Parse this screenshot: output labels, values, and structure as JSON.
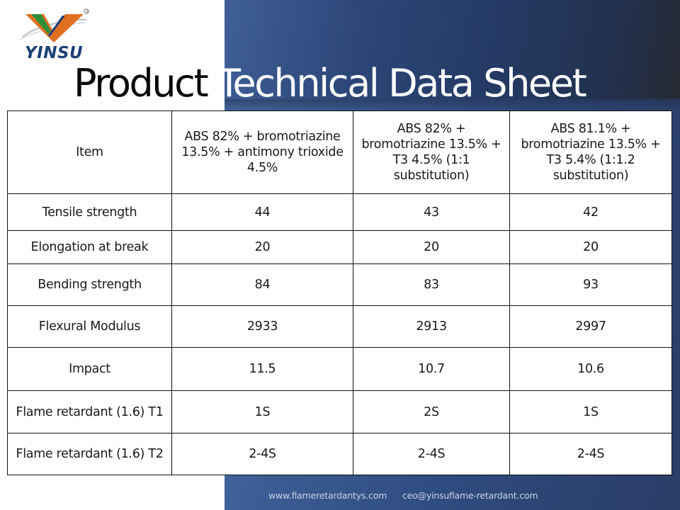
{
  "brand": {
    "name": "YINSU",
    "registered_mark": "®",
    "colors": {
      "green": "#2f8f3a",
      "orange": "#e07020",
      "navy": "#1c3f78"
    }
  },
  "title": {
    "part1": "Product",
    "part2": "Technical Data Sheet"
  },
  "table": {
    "headers": [
      "Item",
      "ABS 82% + bromotriazine 13.5% + antimony trioxide 4.5%",
      "ABS 82% + bromotriazine 13.5% + T3 4.5% (1:1 substitution)",
      "ABS 81.1% + bromotriazine 13.5% + T3 5.4% (1:1.2 substitution)"
    ],
    "rows": [
      {
        "item": "Tensile strength",
        "values": [
          "44",
          "43",
          "42"
        ]
      },
      {
        "item": "Elongation at break",
        "values": [
          "20",
          "20",
          "20"
        ]
      },
      {
        "item": "Bending strength",
        "values": [
          "84",
          "83",
          "93"
        ]
      },
      {
        "item": "Flexural Modulus",
        "values": [
          "2933",
          "2913",
          "2997"
        ]
      },
      {
        "item": "Impact",
        "values": [
          "11.5",
          "10.7",
          "10.6"
        ]
      },
      {
        "item": "Flame retardant (1.6) T1",
        "values": [
          "1S",
          "2S",
          "1S"
        ]
      },
      {
        "item": "Flame retardant (1.6) T2",
        "values": [
          "2-4S",
          "2-4S",
          "2-4S"
        ]
      }
    ]
  },
  "footer": {
    "website": "www.flameretardantys.com",
    "email": "ceo@yinsuflame-retardant.com"
  },
  "theme": {
    "panel_blue": "#3a5b92",
    "panel_dark": "#22304d",
    "footer_text": "#c9d3e6"
  }
}
